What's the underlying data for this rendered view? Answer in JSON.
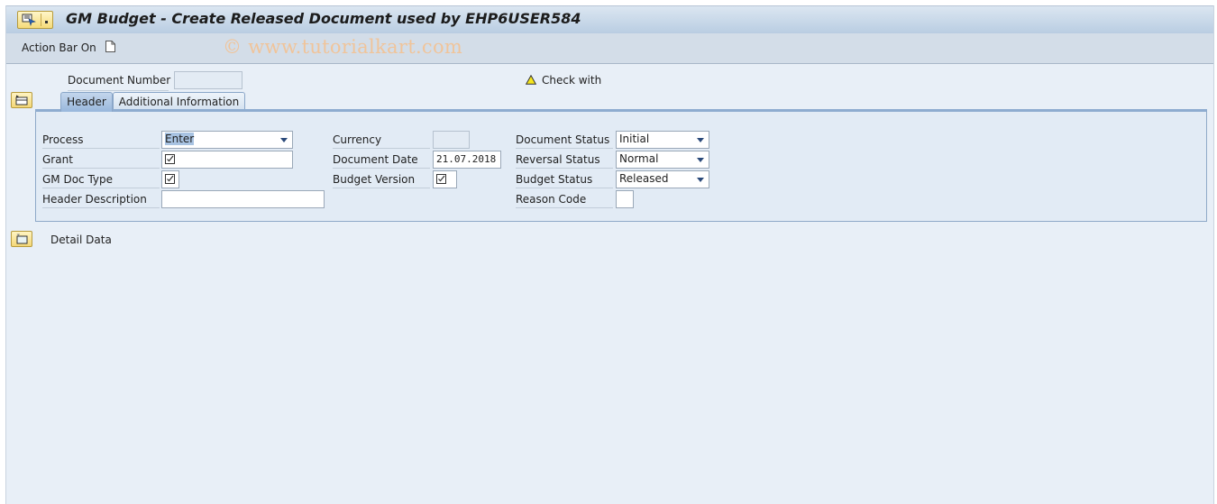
{
  "window": {
    "title": "GM Budget - Create Released Document used by EHP6USER584"
  },
  "toolbar": {
    "action_bar_label": "Action Bar On",
    "watermark": "© www.tutorialkart.com"
  },
  "top_fields": {
    "document_number_label": "Document Number",
    "document_number_value": "",
    "check_with_label": "Check with"
  },
  "tabs": [
    {
      "label": "Header",
      "active": true
    },
    {
      "label": "Additional Information",
      "active": false
    }
  ],
  "header_form": {
    "col1": [
      {
        "label": "Process",
        "value": "Enter",
        "type": "dropdown"
      },
      {
        "label": "Grant",
        "value": "",
        "type": "input-required"
      },
      {
        "label": "GM Doc Type",
        "value": "",
        "type": "input-required"
      },
      {
        "label": "Header Description",
        "value": "",
        "type": "input"
      }
    ],
    "col2": [
      {
        "label": "Currency",
        "value": "",
        "type": "readonly"
      },
      {
        "label": "Document Date",
        "value": "21.07.2018",
        "type": "input"
      },
      {
        "label": "Budget Version",
        "value": "",
        "type": "input-required"
      }
    ],
    "col3": [
      {
        "label": "Document Status",
        "value": "Initial",
        "type": "dropdown"
      },
      {
        "label": "Reversal Status",
        "value": "Normal",
        "type": "dropdown"
      },
      {
        "label": "Budget Status",
        "value": "Released",
        "type": "dropdown"
      },
      {
        "label": "Reason Code",
        "value": "",
        "type": "input"
      }
    ]
  },
  "detail_section": {
    "label": "Detail  Data"
  },
  "colors": {
    "background": "#e8eff7",
    "title_bar": "#c8d8ea",
    "watermark": "#f0c49a",
    "button_yellow": "#f5db7a"
  }
}
